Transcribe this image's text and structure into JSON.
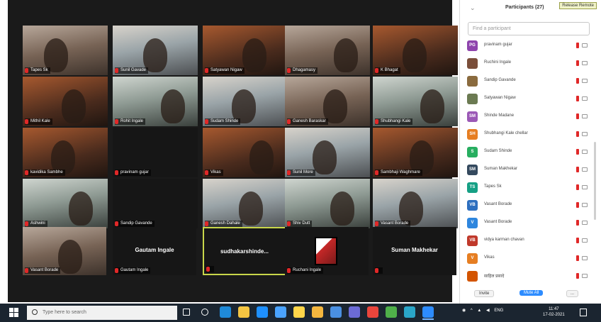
{
  "panel": {
    "title": "Participants (27)",
    "release_button": "Release Remote",
    "search_placeholder": "Find a participant",
    "participants": [
      {
        "initials": "PG",
        "name": "pravinam gujar",
        "color": "#8e44ad"
      },
      {
        "initials": "",
        "name": "Ruchini Ingale",
        "color": "#7a4e3a"
      },
      {
        "initials": "",
        "name": "Sandip Gavande",
        "color": "#8a6b3e"
      },
      {
        "initials": "",
        "name": "Satyawan Nigaw",
        "color": "#6b7a52"
      },
      {
        "initials": "SM",
        "name": "Shinde Madane",
        "color": "#9b59b6"
      },
      {
        "initials": "SH",
        "name": "Shubhangi Kale chellar",
        "color": "#e67e22"
      },
      {
        "initials": "S",
        "name": "Sudam Shinde",
        "color": "#27ae60"
      },
      {
        "initials": "SM",
        "name": "Suman Makhekar",
        "color": "#34495e"
      },
      {
        "initials": "TS",
        "name": "Tapes Sk",
        "color": "#16a085"
      },
      {
        "initials": "VB",
        "name": "Vasant Borade",
        "color": "#2d6fbf"
      },
      {
        "initials": "V",
        "name": "Vasant Borade",
        "color": "#2e86de"
      },
      {
        "initials": "VB",
        "name": "vidya karman chavan",
        "color": "#c0392b"
      },
      {
        "initials": "V",
        "name": "Vikas",
        "color": "#e67e22"
      },
      {
        "initials": "",
        "name": "साहिल प्रसादे",
        "color": "#d35400"
      }
    ],
    "footer": {
      "invite": "Invite",
      "mute_all": "Mute All",
      "more": "..."
    }
  },
  "gallery": {
    "tiles": [
      {
        "name": "Tapes Sk",
        "style": "v1"
      },
      {
        "name": "Sunil Gavade",
        "style": "v2"
      },
      {
        "name": "Satyawan Nigaw",
        "style": "v3"
      },
      {
        "name": "Dhagamasy",
        "style": "v1"
      },
      {
        "name": "K Bhagat",
        "style": "v3"
      },
      {
        "name": "Mithil Kale",
        "style": "v3"
      },
      {
        "name": "Rohit Ingale",
        "style": "v4"
      },
      {
        "name": "Sudam Shinde",
        "style": "v2"
      },
      {
        "name": "Ganesh Baraskar",
        "style": "v1"
      },
      {
        "name": "Shubhangi Kale",
        "style": "v4"
      },
      {
        "name": "kavidika Sambhe",
        "style": "v3"
      },
      {
        "name": "pravinam gujar",
        "style": "black"
      },
      {
        "name": "Vikas",
        "style": "v3"
      },
      {
        "name": "Sunil More",
        "style": "v2"
      },
      {
        "name": "Sambhaji Waghmare",
        "style": "v3"
      },
      {
        "name": "Ashwini",
        "style": "v4"
      },
      {
        "name": "Sandip Gavande",
        "style": "black"
      },
      {
        "name": "Ganesh Dahale",
        "style": "v2"
      },
      {
        "name": "Shiv Dutt",
        "style": "v4"
      },
      {
        "name": "Vasant Borade",
        "style": "v2"
      },
      {
        "name": "Vasant Borade",
        "style": "v1"
      },
      {
        "name": "Gautam Ingale",
        "style": "black",
        "center": "Gautam Ingale"
      },
      {
        "name": "",
        "style": "black",
        "center": "sudhakarshinde...",
        "active": true
      },
      {
        "name": "Ruchani Ingale",
        "style": "flag"
      },
      {
        "name": "",
        "style": "black",
        "center": "Suman Makhekar"
      }
    ]
  },
  "taskbar": {
    "search_placeholder": "Type here to search",
    "tray_text": "ENG",
    "time": "11:47",
    "date": "17-02-2021"
  }
}
